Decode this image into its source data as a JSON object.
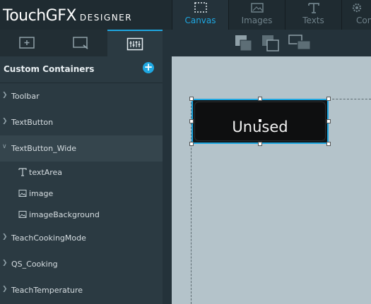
{
  "app": {
    "brand": "TouchGFX",
    "subtitle": "DESIGNER"
  },
  "top_tabs": [
    {
      "label": "Canvas",
      "icon": "canvas-icon",
      "active": true
    },
    {
      "label": "Images",
      "icon": "image-icon",
      "active": false
    },
    {
      "label": "Texts",
      "icon": "text-icon",
      "active": false
    },
    {
      "label": "Con",
      "icon": "gear-icon",
      "active": false
    }
  ],
  "panel_tabs": [
    "add-widget-icon",
    "screen-icon",
    "custom-container-icon"
  ],
  "custom_containers": {
    "title": "Custom Containers",
    "add_icon": "+",
    "items": [
      {
        "label": "Toolbar",
        "indent": 0
      },
      {
        "label": "TextButton",
        "indent": 0
      },
      {
        "label": "TextButton_Wide",
        "indent": 0,
        "selected": true
      },
      {
        "label": "textArea",
        "indent": 1,
        "icon": "text-icon"
      },
      {
        "label": "image",
        "indent": 1,
        "icon": "image-icon"
      },
      {
        "label": "imageBackground",
        "indent": 1,
        "icon": "image-icon"
      },
      {
        "label": "TeachCookingMode",
        "indent": 0
      },
      {
        "label": "QS_Cooking",
        "indent": 0
      },
      {
        "label": "TeachTemperature",
        "indent": 0
      }
    ]
  },
  "canvas": {
    "widget_text": "Unused"
  },
  "colors": {
    "accent": "#1ea7e1",
    "panel": "#2b3a42",
    "topbar": "#1f2b31",
    "canvas": "#b4c3ca"
  }
}
